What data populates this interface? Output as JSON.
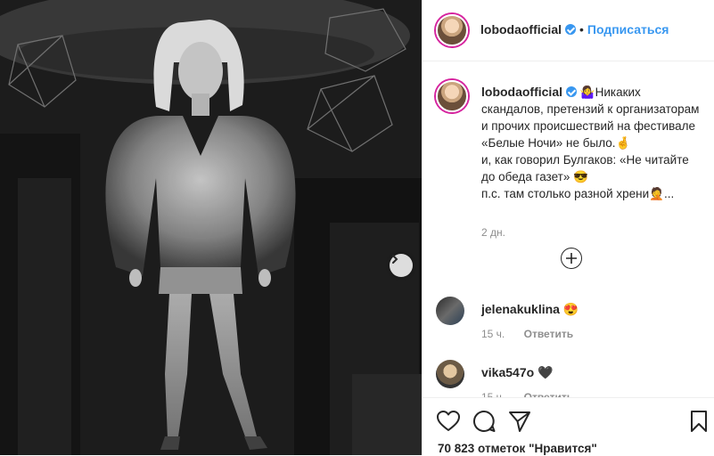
{
  "post": {
    "username": "lobodaofficial",
    "follow_label": "Подписаться",
    "caption_text": "🤷‍♀️Никаких скандалов, претензий к организаторам и прочих происшествий на фестивале «Белые Ночи» не было.🤞\nи, как говорил Булгаков: «Не читайте до обеда газет» 😎\nп.с. там столько разной хрени🤦...",
    "age": "2 дн.",
    "icons": {
      "next": "chevron-right-icon",
      "load_more": "plus-circle-icon",
      "verified": "verified-badge-icon"
    }
  },
  "comments": [
    {
      "username": "jelenakuklina",
      "text": "😍",
      "age": "15 ч.",
      "reply_label": "Ответить"
    },
    {
      "username": "vika547o",
      "text": "🖤",
      "age": "15 ч.",
      "reply_label": "Ответить"
    }
  ],
  "actions": {
    "icons": [
      "heart-icon",
      "comment-icon",
      "share-icon",
      "bookmark-icon"
    ],
    "likes_text": "70 823 отметок \"Нравится\""
  },
  "colors": {
    "accent": "#3897f0",
    "text": "#262626",
    "muted": "#8e8e8e",
    "border": "#efefef"
  }
}
